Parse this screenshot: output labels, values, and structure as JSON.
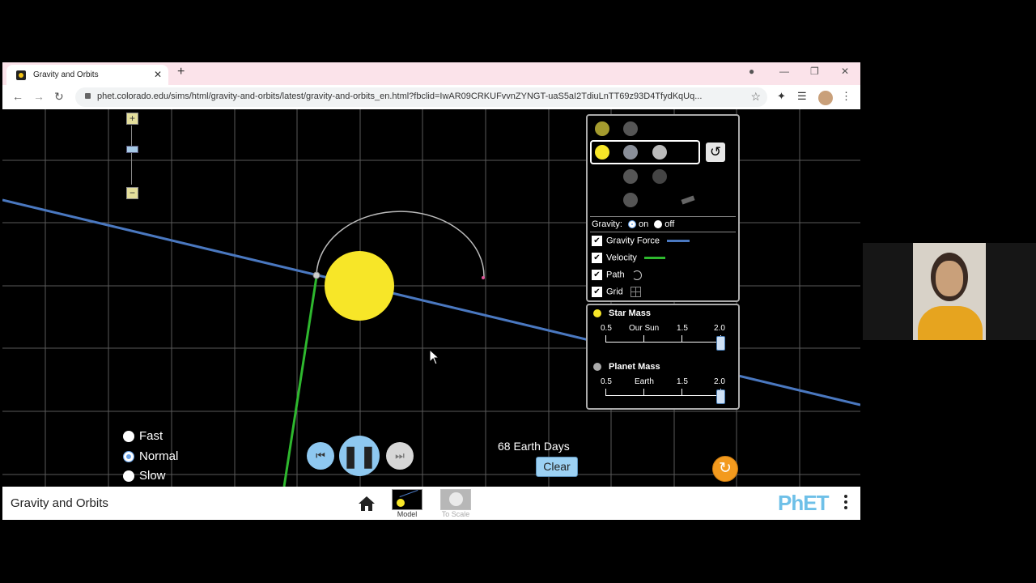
{
  "browser": {
    "tab_title": "Gravity and Orbits",
    "tab_close": "✕",
    "new_tab": "+",
    "window": {
      "minimize": "—",
      "restore": "❐",
      "close": "✕"
    },
    "url": "phet.colorado.edu/sims/html/gravity-and-orbits/latest/gravity-and-orbits_en.html?fbclid=IwAR09CRKUFvvnZYNGT-uaS5aI2TdiuLnTT69z93D4TfydKqUq..."
  },
  "zoom": {
    "plus": "+",
    "minus": "−"
  },
  "controls": {
    "gravity_label": "Gravity:",
    "gravity_on": "on",
    "gravity_off": "off",
    "gravity_selected": "on",
    "checkboxes": [
      {
        "label": "Gravity Force",
        "checked": true,
        "color": "#4a78c0"
      },
      {
        "label": "Velocity",
        "checked": true,
        "color": "#2eb82e"
      },
      {
        "label": "Path",
        "checked": true
      },
      {
        "label": "Grid",
        "checked": true
      }
    ]
  },
  "mass": {
    "star": {
      "title": "Star Mass",
      "ticks": [
        "0.5",
        "Our Sun",
        "1.5",
        "2.0"
      ],
      "value": 2.0
    },
    "planet": {
      "title": "Planet Mass",
      "ticks": [
        "0.5",
        "Earth",
        "1.5",
        "2.0"
      ],
      "value": 2.0
    }
  },
  "time": {
    "readout": "68 Earth Days",
    "clear": "Clear"
  },
  "speed": {
    "options": [
      "Fast",
      "Normal",
      "Slow"
    ],
    "selected": "Normal"
  },
  "navbar": {
    "sim_title": "Gravity and Orbits",
    "screens": [
      {
        "label": "Model",
        "active": true
      },
      {
        "label": "To Scale",
        "active": false
      }
    ],
    "logo": "PhET"
  },
  "colors": {
    "star": "#f7e628",
    "force": "#4a78c0",
    "velocity": "#2eb82e",
    "grid": "#555555",
    "accent": "#6aa3e8"
  }
}
